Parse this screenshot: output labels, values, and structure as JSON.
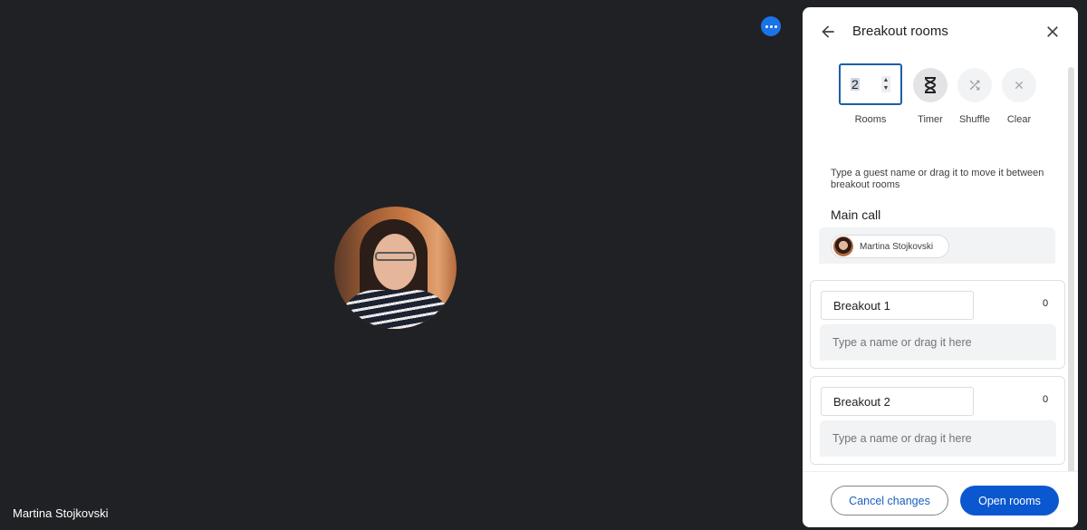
{
  "stage": {
    "participant_name": "Martina Stojkovski",
    "more_options_icon": "more-horizontal-icon"
  },
  "panel": {
    "title": "Breakout rooms",
    "back_icon": "arrow-back-icon",
    "close_icon": "close-icon",
    "controls": {
      "rooms_value": "2",
      "rooms_label": "Rooms",
      "timer_label": "Timer",
      "shuffle_label": "Shuffle",
      "clear_label": "Clear"
    },
    "instructions": "Type a guest name or drag it to move it between breakout rooms",
    "main_call": {
      "title": "Main call",
      "participants": [
        {
          "name": "Martina Stojkovski"
        }
      ]
    },
    "rooms": [
      {
        "name": "Breakout 1",
        "count": "0",
        "placeholder": "Type a name or drag it here"
      },
      {
        "name": "Breakout 2",
        "count": "0",
        "placeholder": "Type a name or drag it here"
      }
    ],
    "footer": {
      "cancel_label": "Cancel changes",
      "open_label": "Open rooms"
    }
  },
  "colors": {
    "background": "#202124",
    "primary": "#0b57d0",
    "focus_border": "#1a5fa8"
  }
}
